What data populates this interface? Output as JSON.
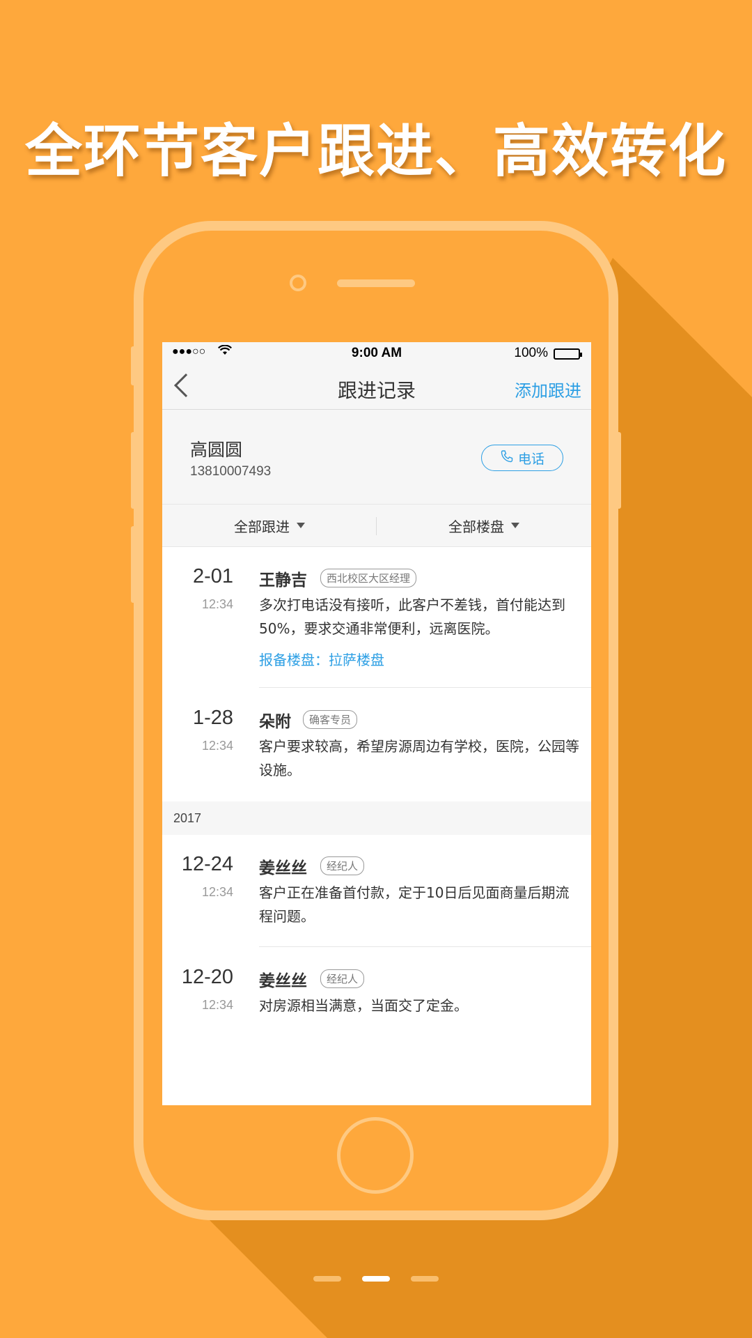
{
  "headline": "全环节客户跟进、高效转化",
  "status_bar": {
    "signal": "●●●○○",
    "wifi_icon": "wifi-icon",
    "time": "9:00 AM",
    "battery": "100%"
  },
  "navbar": {
    "title": "跟进记录",
    "add_label": "添加跟进"
  },
  "customer": {
    "name": "高圆圆",
    "phone": "13810007493",
    "call_label": "电话"
  },
  "filters": {
    "follow": "全部跟进",
    "property": "全部楼盘"
  },
  "records_recent": [
    {
      "date": "2-01",
      "time": "12:34",
      "author": "王静吉",
      "role": "西北校区大区经理",
      "content": "多次打电话没有接听，此客户不差钱，首付能达到50%，要求交通非常便利，远离医院。",
      "link": "报备楼盘：拉萨楼盘"
    },
    {
      "date": "1-28",
      "time": "12:34",
      "author": "朵附",
      "role": "确客专员",
      "content": "客户要求较高，希望房源周边有学校，医院，公园等设施。"
    }
  ],
  "year_label": "2017",
  "records_2017": [
    {
      "date": "12-24",
      "time": "12:34",
      "author": "姜丝丝",
      "role": "经纪人",
      "content": "客户正在准备首付款，定于10日后见面商量后期流程问题。"
    },
    {
      "date": "12-20",
      "time": "12:34",
      "author": "姜丝丝",
      "role": "经纪人",
      "content": "对房源相当满意，当面交了定金。"
    }
  ],
  "colors": {
    "background": "#FEA83C",
    "shadow": "#E48F1F",
    "phone_frame": "#FEC982",
    "accent": "#2D9FE4"
  },
  "pager": {
    "total": 3,
    "active": 2
  }
}
